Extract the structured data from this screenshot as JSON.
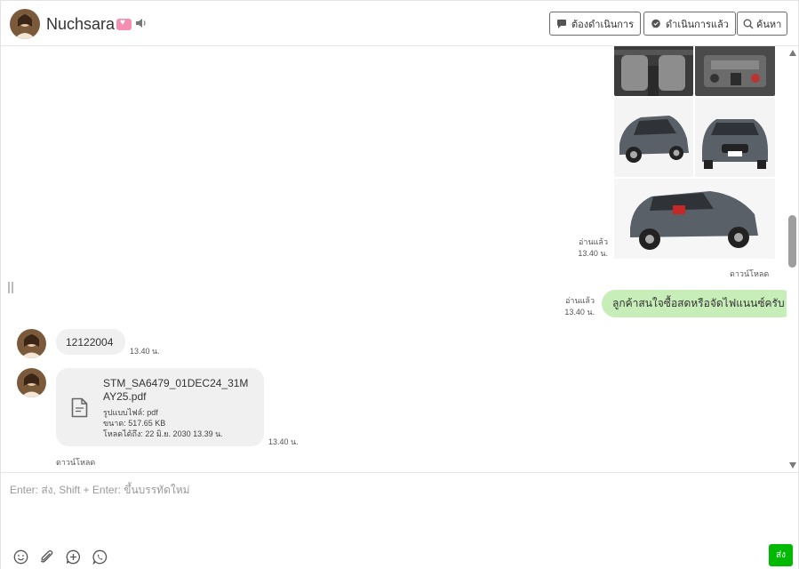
{
  "header": {
    "contact_name": "Nuchsara",
    "buttons": {
      "todo": "ต้องดำเนินการ",
      "done": "ดำเนินการแล้ว",
      "search": "ค้นหา"
    }
  },
  "messages": {
    "image_group": {
      "read_status": "อ่านแล้ว",
      "time": "13.40 น.",
      "download": "ดาวน์โหลด"
    },
    "outgoing_text": {
      "read_status": "อ่านแล้ว",
      "time": "13.40 น.",
      "text": "ลูกค้าสนใจซื้อสดหรือจัดไฟแนนซ์ครับ"
    },
    "incoming_number": {
      "text": "12122004",
      "time": "13.40 น."
    },
    "incoming_file": {
      "file_name": "STM_SA6479_01DEC24_31MAY25.pdf",
      "format_line": "รูปแบบไฟล์: pdf",
      "size_line": "ขนาด: 517.65 KB",
      "expiry_line": "โหลดได้ถึง: 22 มิ.ย. 2030 13.39 น.",
      "time": "13.40 น.",
      "download": "ดาวน์โหลด"
    }
  },
  "composer": {
    "placeholder": "Enter: ส่ง, Shift + Enter: ขึ้นบรรทัดใหม่",
    "send_label": "ส่ง"
  },
  "colors": {
    "outgoing_bubble": "#c7edb9",
    "incoming_bubble": "#f0f0f0",
    "send_button": "#00b900"
  },
  "icons": [
    "speaker-icon",
    "chat-todo-icon",
    "chat-done-icon",
    "search-icon",
    "document-icon",
    "emoji-icon",
    "attachment-icon",
    "add-icon",
    "whatsapp-icon"
  ]
}
